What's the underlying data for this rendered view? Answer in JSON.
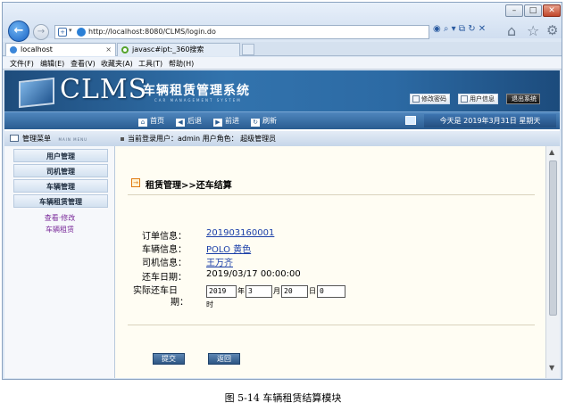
{
  "browser": {
    "url": "http://localhost:8080/CLMS/login.do",
    "tabs": [
      {
        "label": "localhost",
        "close": "×"
      },
      {
        "label": "javasc#ipt:_360搜索",
        "close": ""
      }
    ],
    "menu": [
      "文件(F)",
      "编辑(E)",
      "查看(V)",
      "收藏夹(A)",
      "工具(T)",
      "帮助(H)"
    ]
  },
  "header": {
    "logo": "CLMS",
    "title": "车辆租赁管理系统",
    "subtitle": "CAR MANAGEMENT SYSTEM",
    "btn_password": "修改密码",
    "btn_userinfo": "用户信息",
    "btn_exit": "退出系统"
  },
  "nav": {
    "home": "首页",
    "back": "后退",
    "forward": "前进",
    "refresh": "刷新",
    "date": "今天是 2019年3月31日 星期天"
  },
  "sidebar": {
    "title": "管理菜单",
    "title_en": "MAIN MENU",
    "items": [
      "用户管理",
      "司机管理",
      "车辆管理",
      "车辆租赁管理"
    ],
    "links": [
      "查看·修改",
      "车辆租赁"
    ]
  },
  "userbar": {
    "text": "当前登录用户：admin  用户角色： 超级管理员"
  },
  "page": {
    "title": "租赁管理>>还车结算",
    "order_label": "订单信息：",
    "order_value": "201903160001",
    "car_label": "车辆信息：",
    "car_value": "POLO 黄色",
    "driver_label": "司机信息：",
    "driver_value": "王万齐",
    "return_label": "还车日期：",
    "return_value": "2019/03/17 00:00:00",
    "actual_label_1": "实际还车日",
    "actual_label_2": "期：",
    "year": "2019",
    "year_unit": "年",
    "month": "3",
    "month_unit": "月",
    "day": "20",
    "day_unit": "日",
    "hour": "0",
    "hour_unit": "时",
    "submit": "提交",
    "back": "返回"
  },
  "caption": "图 5-14  车辆租赁结算模块"
}
